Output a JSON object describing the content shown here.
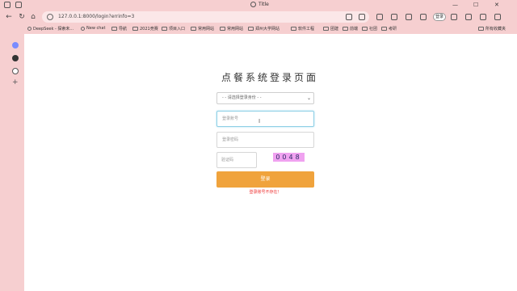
{
  "browser": {
    "tab_title": "Title",
    "url": "127.0.0.1:8000/login?errinfo=3",
    "profile_label": "登录",
    "bookmarks": [
      "DeepSeek - 探索未...",
      "New chat",
      "导航",
      "2021竞赛",
      "项目入口",
      "常用网站",
      "常用网站",
      "郑州大学网站",
      "软件工程",
      "团建",
      "前端",
      "社团",
      "考研"
    ],
    "other_bookmarks": "所有收藏夹"
  },
  "login": {
    "title": "点餐系统登录页面",
    "select_placeholder": "- - 请选择登录身份 - -",
    "account_placeholder": "登录账号",
    "password_placeholder": "登录密码",
    "captcha_placeholder": "验证码",
    "captcha_code": "0048",
    "login_button": "登录",
    "error_message": "登录账号不存在！"
  },
  "colors": {
    "chrome_bg": "#f6cfd0",
    "button_bg": "#f0a33c",
    "captcha_bg": "#f0a2f0",
    "error_text": "#e33333"
  }
}
